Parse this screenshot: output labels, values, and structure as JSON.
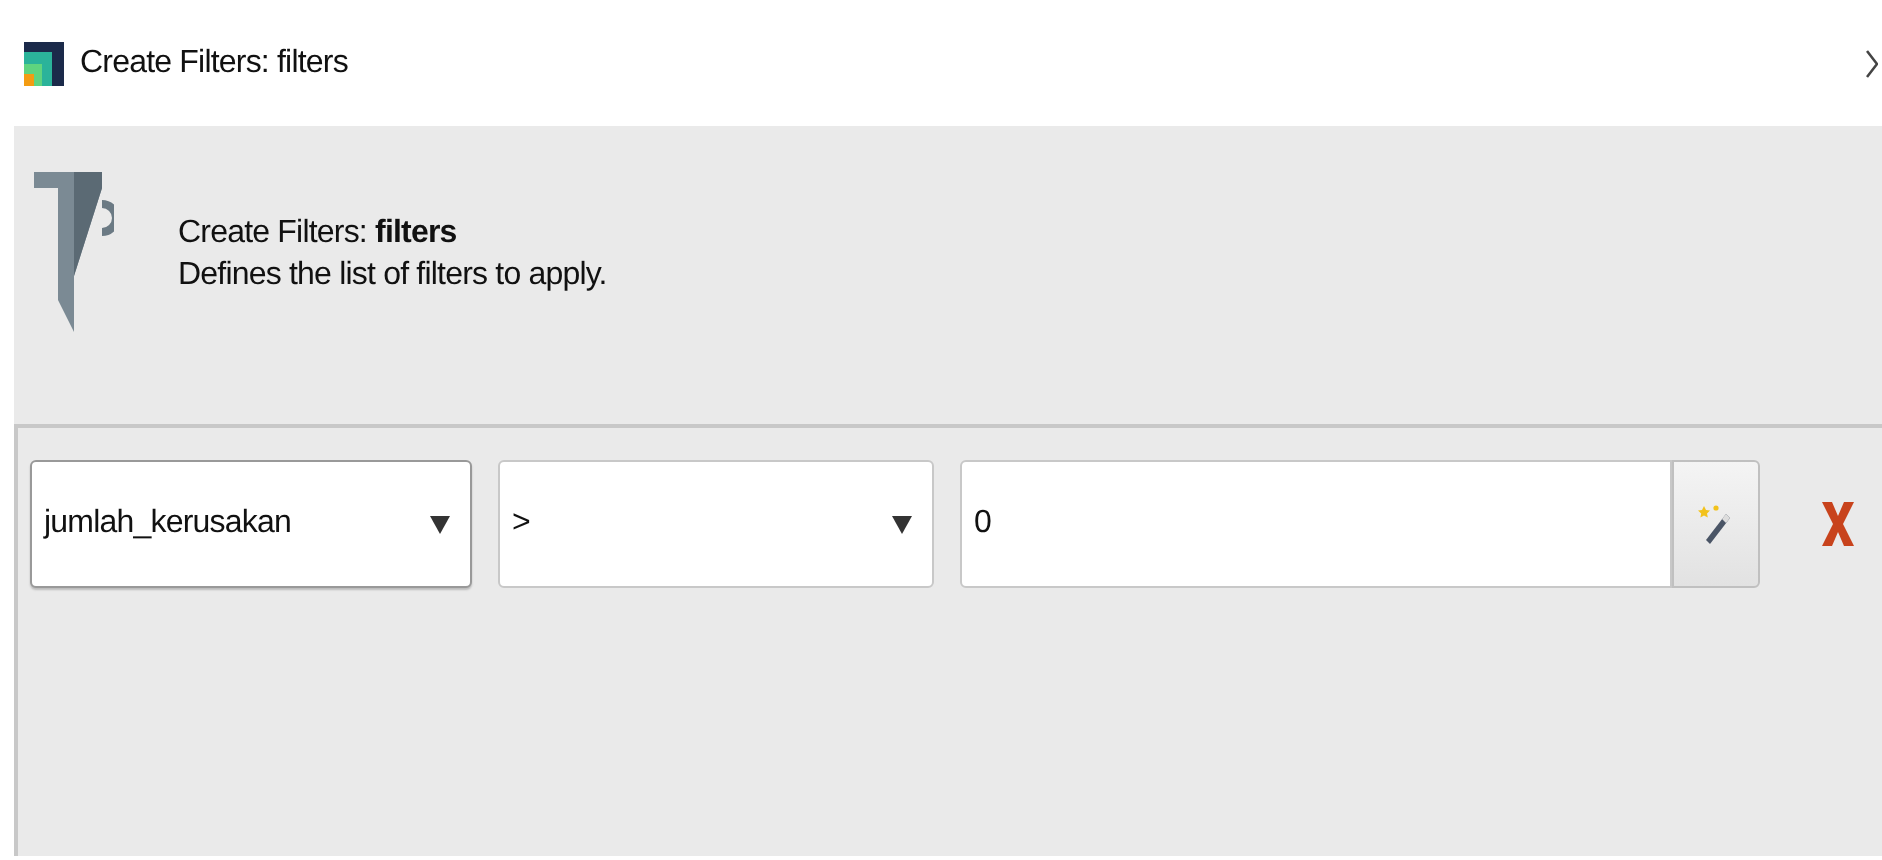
{
  "window": {
    "title": "Create Filters: filters"
  },
  "header": {
    "title": "Create Filters: **filters**",
    "description": "Defines the list of filters to apply."
  },
  "filters": [
    {
      "attribute": "jumlah_kerusakan",
      "operator": ">",
      "value": "0"
    }
  ]
}
